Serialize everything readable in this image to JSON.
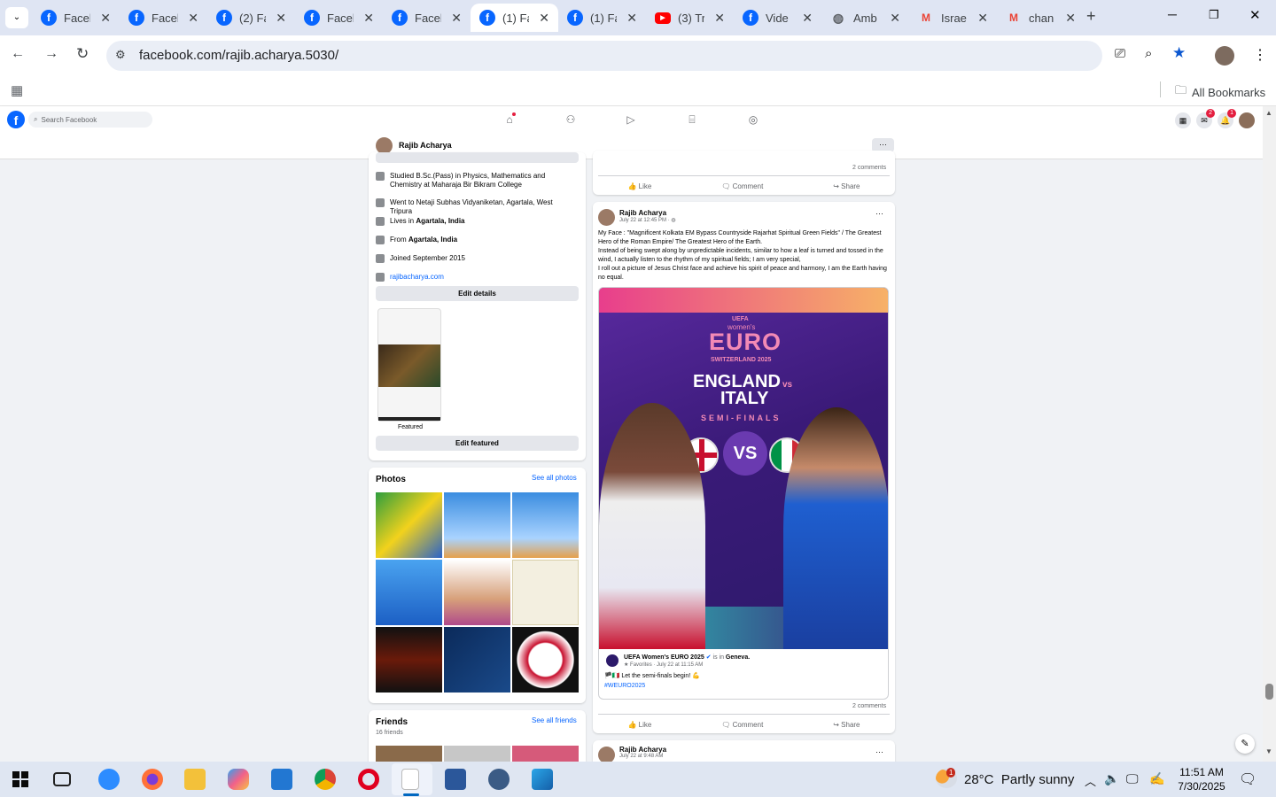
{
  "tabs": [
    {
      "title": "Faceb",
      "icon": "facebook-icon",
      "color": "#0866ff"
    },
    {
      "title": "Faceb",
      "icon": "facebook-icon",
      "color": "#0866ff"
    },
    {
      "title": "(2) Fa",
      "icon": "facebook-icon",
      "color": "#0866ff"
    },
    {
      "title": "Faceb",
      "icon": "facebook-icon",
      "color": "#0866ff"
    },
    {
      "title": "Faceb",
      "icon": "facebook-icon",
      "color": "#0866ff"
    },
    {
      "title": "(1) Fa",
      "icon": "facebook-icon",
      "color": "#0866ff"
    },
    {
      "title": "(1) Fa",
      "icon": "facebook-icon",
      "color": "#0866ff"
    },
    {
      "title": "(3) Tr",
      "icon": "youtube-icon",
      "color": "#ff0000"
    },
    {
      "title": "Vide",
      "icon": "facebook-icon",
      "color": "#0866ff"
    },
    {
      "title": "Amb",
      "icon": "globe-icon",
      "color": "#5f6368"
    },
    {
      "title": "Israe",
      "icon": "gmail-icon",
      "color": "#ea4335"
    },
    {
      "title": "chan",
      "icon": "gmail-icon",
      "color": "#ea4335"
    }
  ],
  "url": "facebook.com/rajib.acharya.5030/",
  "bookmarks_label": "All Bookmarks",
  "search_placeholder": "Search Facebook",
  "badges": {
    "messenger": "2",
    "notifications": "1"
  },
  "profile_name": "Rajib Acharya",
  "intro": [
    {
      "text": "Studied B.Sc.(Pass) in Physics, Mathematics and Chemistry at Maharaja Bir Bikram College",
      "icon": "school-icon"
    },
    {
      "text": "Went to Netaji Subhas Vidyaniketan, Agartala, West Tripura",
      "icon": "school-icon"
    },
    {
      "pre": "Lives in ",
      "bold": "Agartala, India",
      "icon": "home-icon"
    },
    {
      "pre": "From ",
      "bold": "Agartala, India",
      "icon": "location-icon"
    },
    {
      "text": "Joined September 2015",
      "icon": "clock-icon"
    },
    {
      "text": "rajibacharya.com",
      "icon": "link-icon"
    }
  ],
  "edit_details": "Edit details",
  "featured_label": "Featured",
  "edit_featured": "Edit featured",
  "photos": {
    "title": "Photos",
    "see_all": "See all photos"
  },
  "friends": {
    "title": "Friends",
    "see_all": "See all friends",
    "count": "16 friends"
  },
  "post_top": {
    "comments": "2 comments"
  },
  "actions": {
    "like": "Like",
    "comment": "Comment",
    "share": "Share"
  },
  "post": {
    "author": "Rajib Acharya",
    "time": "July 22 at 12:45 PM",
    "text1": "My Face : \"Magnificent Kolkata EM Bypass Countryside Rajarhat Spiritual Green Fields\" / The Greatest Hero of the Roman Empire/ The Greatest Hero of the Earth.",
    "text2": "Instead of being swept along by unpredictable incidents, similar to how a leaf is turned and tossed in the wind, I actually listen to the rhythm of my spiritual fields;  I am very special,",
    "text3": " I roll out a picture of Jesus Christ face and achieve his spirit of  peace and harmony, I am the Earth having no equal.",
    "image": {
      "line1": "UEFA",
      "line2": "women's",
      "line3": "EURO",
      "line4": "SWITZERLAND 2025",
      "team1": "ENGLAND",
      "vs": "vs",
      "team2": "ITALY",
      "stage": "SEMI-FINALS",
      "vsbig": "VS"
    },
    "shared_page": "UEFA Women's EURO 2025",
    "shared_is": " is in ",
    "shared_loc": "Geneva.",
    "shared_meta": "★ Favorites · July 22 at 11:15 AM",
    "shared_text": "Let the semi-finals begin! 💪",
    "hashtag": "#WEURO2025",
    "comments": "2 comments"
  },
  "post2": {
    "author": "Rajib Acharya",
    "time": "July 22 at 9:48 AM"
  },
  "taskbar": {
    "temp": "28°C",
    "weather": "Partly sunny",
    "time": "11:51 AM",
    "date": "7/30/2025",
    "weather_badge": "1"
  }
}
